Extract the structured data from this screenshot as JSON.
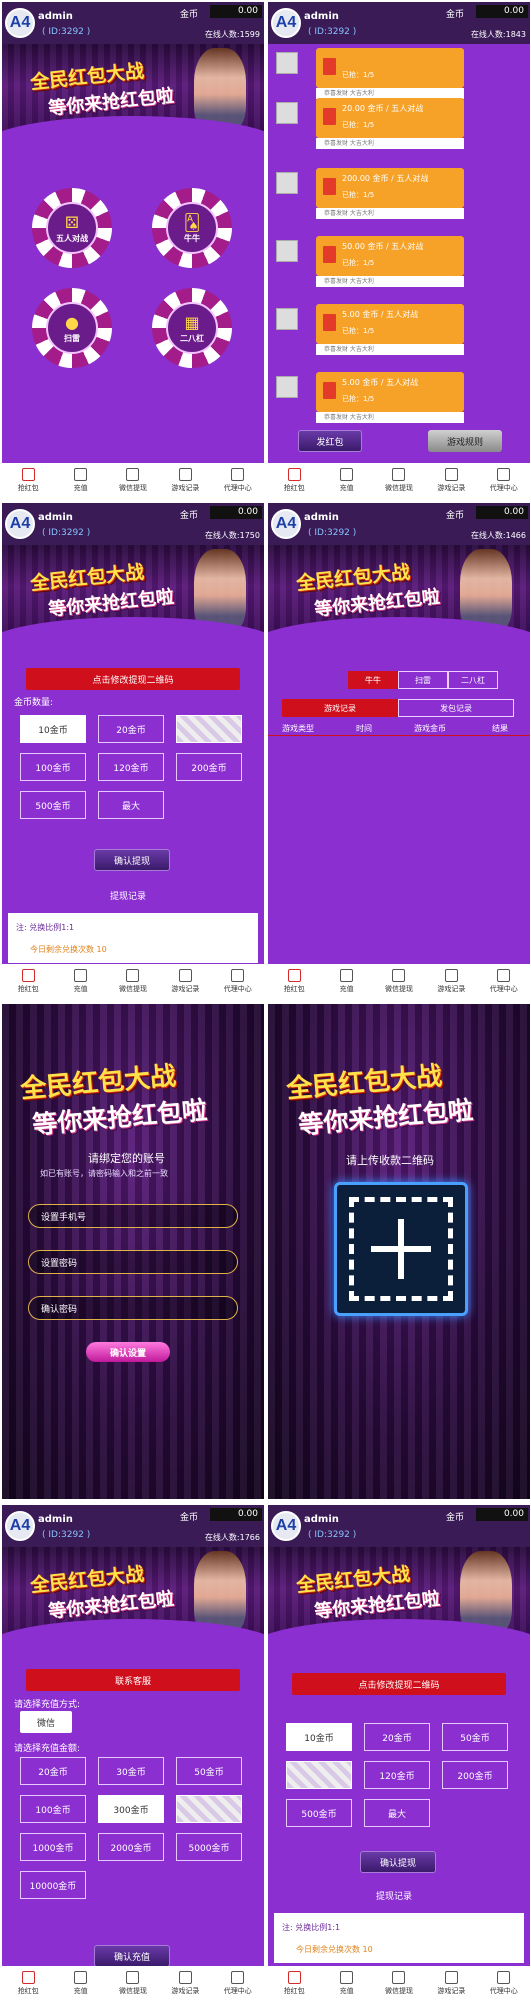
{
  "header": {
    "avatar_text": "A4",
    "username": "admin",
    "user_id": "( ID:3292 )",
    "coin_label": "金币",
    "coin_value": "0.00",
    "online_1599": "在线人数:1599",
    "online_1843": "在线人数:1843",
    "online_1750": "在线人数:1750",
    "online_1466": "在线人数:1466",
    "online_1766": "在线人数:1766"
  },
  "banner": {
    "slogan_line1": "全民红包大战",
    "slogan_line2": "等你来抢红包啦"
  },
  "nav": {
    "grab": "抢红包",
    "recharge": "充值",
    "wechat_withdraw": "微信提现",
    "game_records": "游戏记录",
    "agent_center": "代理中心"
  },
  "panel1": {
    "games": [
      "五人对战",
      "牛牛",
      "扫雷",
      "二八杠"
    ]
  },
  "panel2": {
    "messages": [
      {
        "amount": "",
        "got": "已抢：1/5",
        "footer": "恭喜发财 大吉大利"
      },
      {
        "amount": "20.00 金币 / 五人对战",
        "got": "已抢：1/5",
        "footer": "恭喜发财 大吉大利"
      },
      {
        "amount": "200.00 金币 / 五人对战",
        "got": "已抢：1/5",
        "footer": "恭喜发财 大吉大利"
      },
      {
        "amount": "50.00 金币 / 五人对战",
        "got": "已抢：1/5",
        "footer": "恭喜发财 大吉大利"
      },
      {
        "amount": "5.00 金币 / 五人对战",
        "got": "已抢：1/5",
        "footer": "恭喜发财 大吉大利"
      },
      {
        "amount": "5.00 金币 / 五人对战",
        "got": "已抢：1/5",
        "footer": "恭喜发财 大吉大利"
      }
    ],
    "send_btn": "发红包",
    "rules_btn": "游戏规则"
  },
  "withdraw": {
    "modify_qr": "点击修改提现二维码",
    "coin_qty_label": "金币数量:",
    "options": [
      "10金币",
      "20金币",
      "",
      "100金币",
      "120金币",
      "200金币",
      "500金币",
      "最大"
    ],
    "options_panel8": [
      "10金币",
      "20金币",
      "50金币",
      "",
      "120金币",
      "200金币",
      "500金币",
      "最大"
    ],
    "confirm": "确认提现",
    "records": "提现记录",
    "note_ratio": "注:     兑换比例1:1",
    "note_remaining": "今日剩余兑换次数 10",
    "note_ratio_p8": "注:     兑换比例1:1",
    "note_remaining_p8": "今日剩余兑换次数 10"
  },
  "records_panel": {
    "game_tabs": [
      "牛牛",
      "扫雷",
      "二八杠"
    ],
    "sub_tabs": [
      "游戏记录",
      "发包记录"
    ],
    "columns": [
      "游戏类型",
      "时间",
      "游戏金币",
      "结果"
    ]
  },
  "bind": {
    "title": "请绑定您的账号",
    "hint": "如已有账号，请密码输入和之前一致",
    "phone": "设置手机号",
    "password": "设置密码",
    "confirm_password": "确认密码",
    "confirm": "确认设置"
  },
  "upload": {
    "title": "请上传收款二维码"
  },
  "recharge": {
    "service": "联系客服",
    "method_label": "请选择充值方式:",
    "method": "微信",
    "amount_label": "请选择充值金额:",
    "options": [
      "20金币",
      "30金币",
      "50金币",
      "100金币",
      "300金币",
      "",
      "1000金币",
      "2000金币",
      "5000金币",
      "10000金币"
    ],
    "confirm": "确认充值"
  }
}
